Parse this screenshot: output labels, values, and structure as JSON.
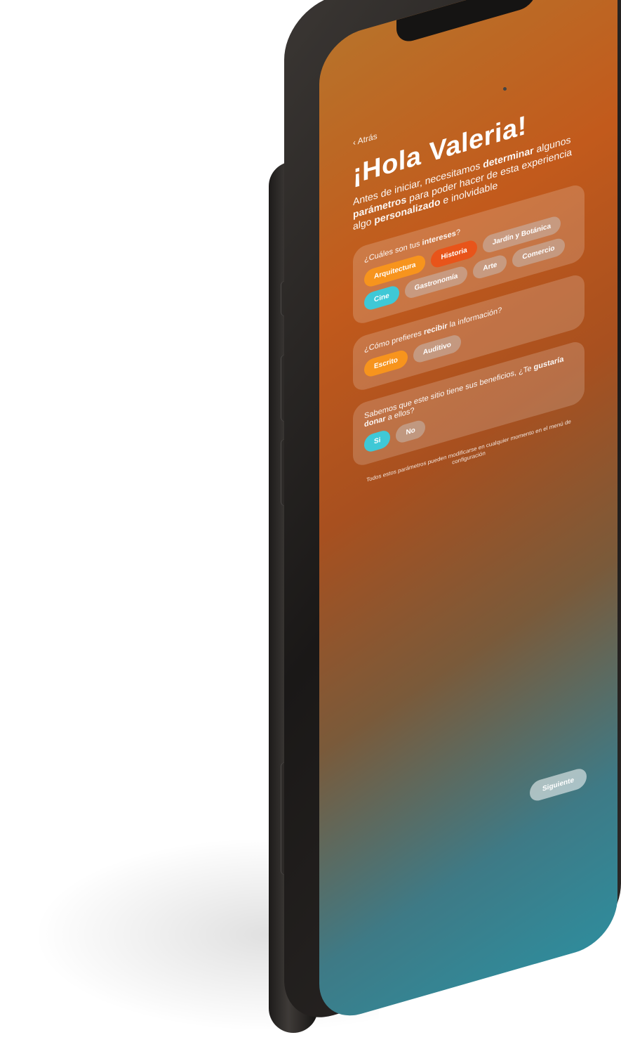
{
  "screen": {
    "back_label": "‹ Atrás",
    "title": "¡Hola Valeria!",
    "intro": {
      "part1": "Antes de iniciar, necesitamos ",
      "bold1": "determinar",
      "part2": " algunos ",
      "bold2": "parámetros",
      "part3": " para poder hacer de esta experiencia algo ",
      "bold3": "personalizado",
      "part4": " e inolvidable"
    }
  },
  "question_interests": {
    "text_part1": "¿Cuáles son tus ",
    "text_bold": "intereses",
    "text_part2": "?",
    "chips": [
      {
        "label": "Arquitectura",
        "style": "orange"
      },
      {
        "label": "Historia",
        "style": "red"
      },
      {
        "label": "Jardín y Botánica",
        "style": "grey"
      },
      {
        "label": "Cine",
        "style": "cyan"
      },
      {
        "label": "Gastronomía",
        "style": "grey"
      },
      {
        "label": "Arte",
        "style": "grey"
      },
      {
        "label": "Comercio",
        "style": "grey"
      }
    ]
  },
  "question_receive": {
    "text_part1": "¿Cómo prefieres ",
    "text_bold": "recibir",
    "text_part2": " la información?",
    "chips": [
      {
        "label": "Escrito",
        "style": "orange"
      },
      {
        "label": "Auditivo",
        "style": "grey"
      }
    ]
  },
  "question_donate": {
    "text_part1": "Sabemos que este sitio tiene sus beneficios, ¿Te ",
    "text_bold": "gustaría donar",
    "text_part2": " a ellos?",
    "chips": [
      {
        "label": "Si",
        "style": "cyan"
      },
      {
        "label": "No",
        "style": "grey"
      }
    ]
  },
  "disclaimer": "Todos estos parámetros pueden modificarse en cualquier momento en el menú de configuración",
  "next_button": "Siguiente"
}
